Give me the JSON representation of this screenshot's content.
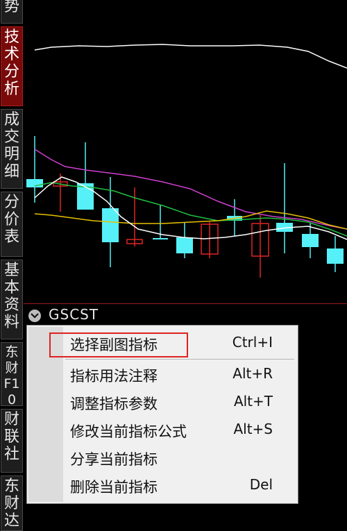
{
  "sidebar": {
    "tabs": [
      {
        "label": "势",
        "active": false
      },
      {
        "label": "技术分析",
        "active": true
      },
      {
        "label": "成交明细",
        "active": false
      },
      {
        "label": "分价表",
        "active": false
      },
      {
        "label": "基本资料",
        "active": false
      },
      {
        "label": "东财F10",
        "active": false
      },
      {
        "label": "财联社",
        "active": false
      },
      {
        "label": "东财达",
        "active": false
      }
    ]
  },
  "sub_chart": {
    "indicator_name": "GSCST",
    "collapse_icon": "chevron-down-icon"
  },
  "context_menu": {
    "items": [
      {
        "label": "选择副图指标",
        "shortcut": "Ctrl+I",
        "highlighted": true
      },
      {
        "label": "指标用法注释",
        "shortcut": "Alt+R"
      },
      {
        "label": "调整指标参数",
        "shortcut": "Alt+T"
      },
      {
        "label": "修改当前指标公式",
        "shortcut": "Alt+S"
      },
      {
        "label": "分享当前指标",
        "shortcut": ""
      },
      {
        "label": "删除当前指标",
        "shortcut": "Del"
      }
    ]
  },
  "colors": {
    "rising_candle": "#e02525",
    "falling_candle": "#55f0f8",
    "ma_white": "#ffffff",
    "ma_yellow": "#e8c000",
    "ma_magenta": "#d040d0",
    "ma_green": "#20c040",
    "divider_red": "#9a1a1a",
    "highlight_box": "#e02020"
  }
}
